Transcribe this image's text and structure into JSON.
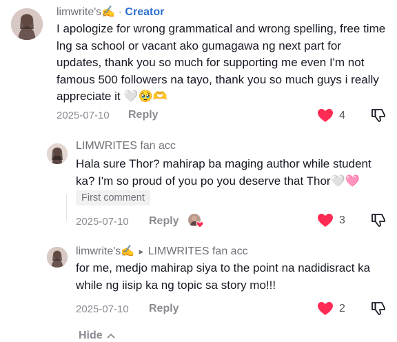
{
  "comment1": {
    "username": "limwrite's✍️",
    "separator": " · ",
    "creator_label": "Creator",
    "text_lines": [
      "I apologize for wrong grammatical and wrong spelling, free time",
      "lng sa school or vacant ako gumagawa ng next part for",
      "updates, thank you so much for supporting me even I'm not",
      "famous 500 followers na tayo, thank you so much guys i really",
      "appreciate it 🤍🥹🫶"
    ],
    "date": "2025-07-10",
    "reply_label": "Reply",
    "likes": "4"
  },
  "reply1": {
    "username": "LIMWRITES fan acc",
    "text_lines": [
      "Hala sure Thor? mahirap ba maging author while student",
      "ka? I'm so proud of you po you deserve that Thor🤍🩷"
    ],
    "badge": "First comment",
    "date": "2025-07-10",
    "reply_label": "Reply",
    "likes": "3"
  },
  "reply2": {
    "username": "limwrite's✍️",
    "arrow": "▸",
    "reply_to": "LIMWRITES fan acc",
    "text_lines": [
      "for me, medjo mahirap siya to the point na nadidisract ka",
      "while ng iisip ka ng topic sa story mo!!!"
    ],
    "date": "2025-07-10",
    "reply_label": "Reply",
    "likes": "2"
  },
  "hide_label": "Hide",
  "colors": {
    "heart": "#fe2c55",
    "creator": "#2b6fcf",
    "muted": "#8a8b91"
  },
  "icons": [
    "heart-icon",
    "thumbs-down-icon",
    "chevron-up-icon"
  ]
}
